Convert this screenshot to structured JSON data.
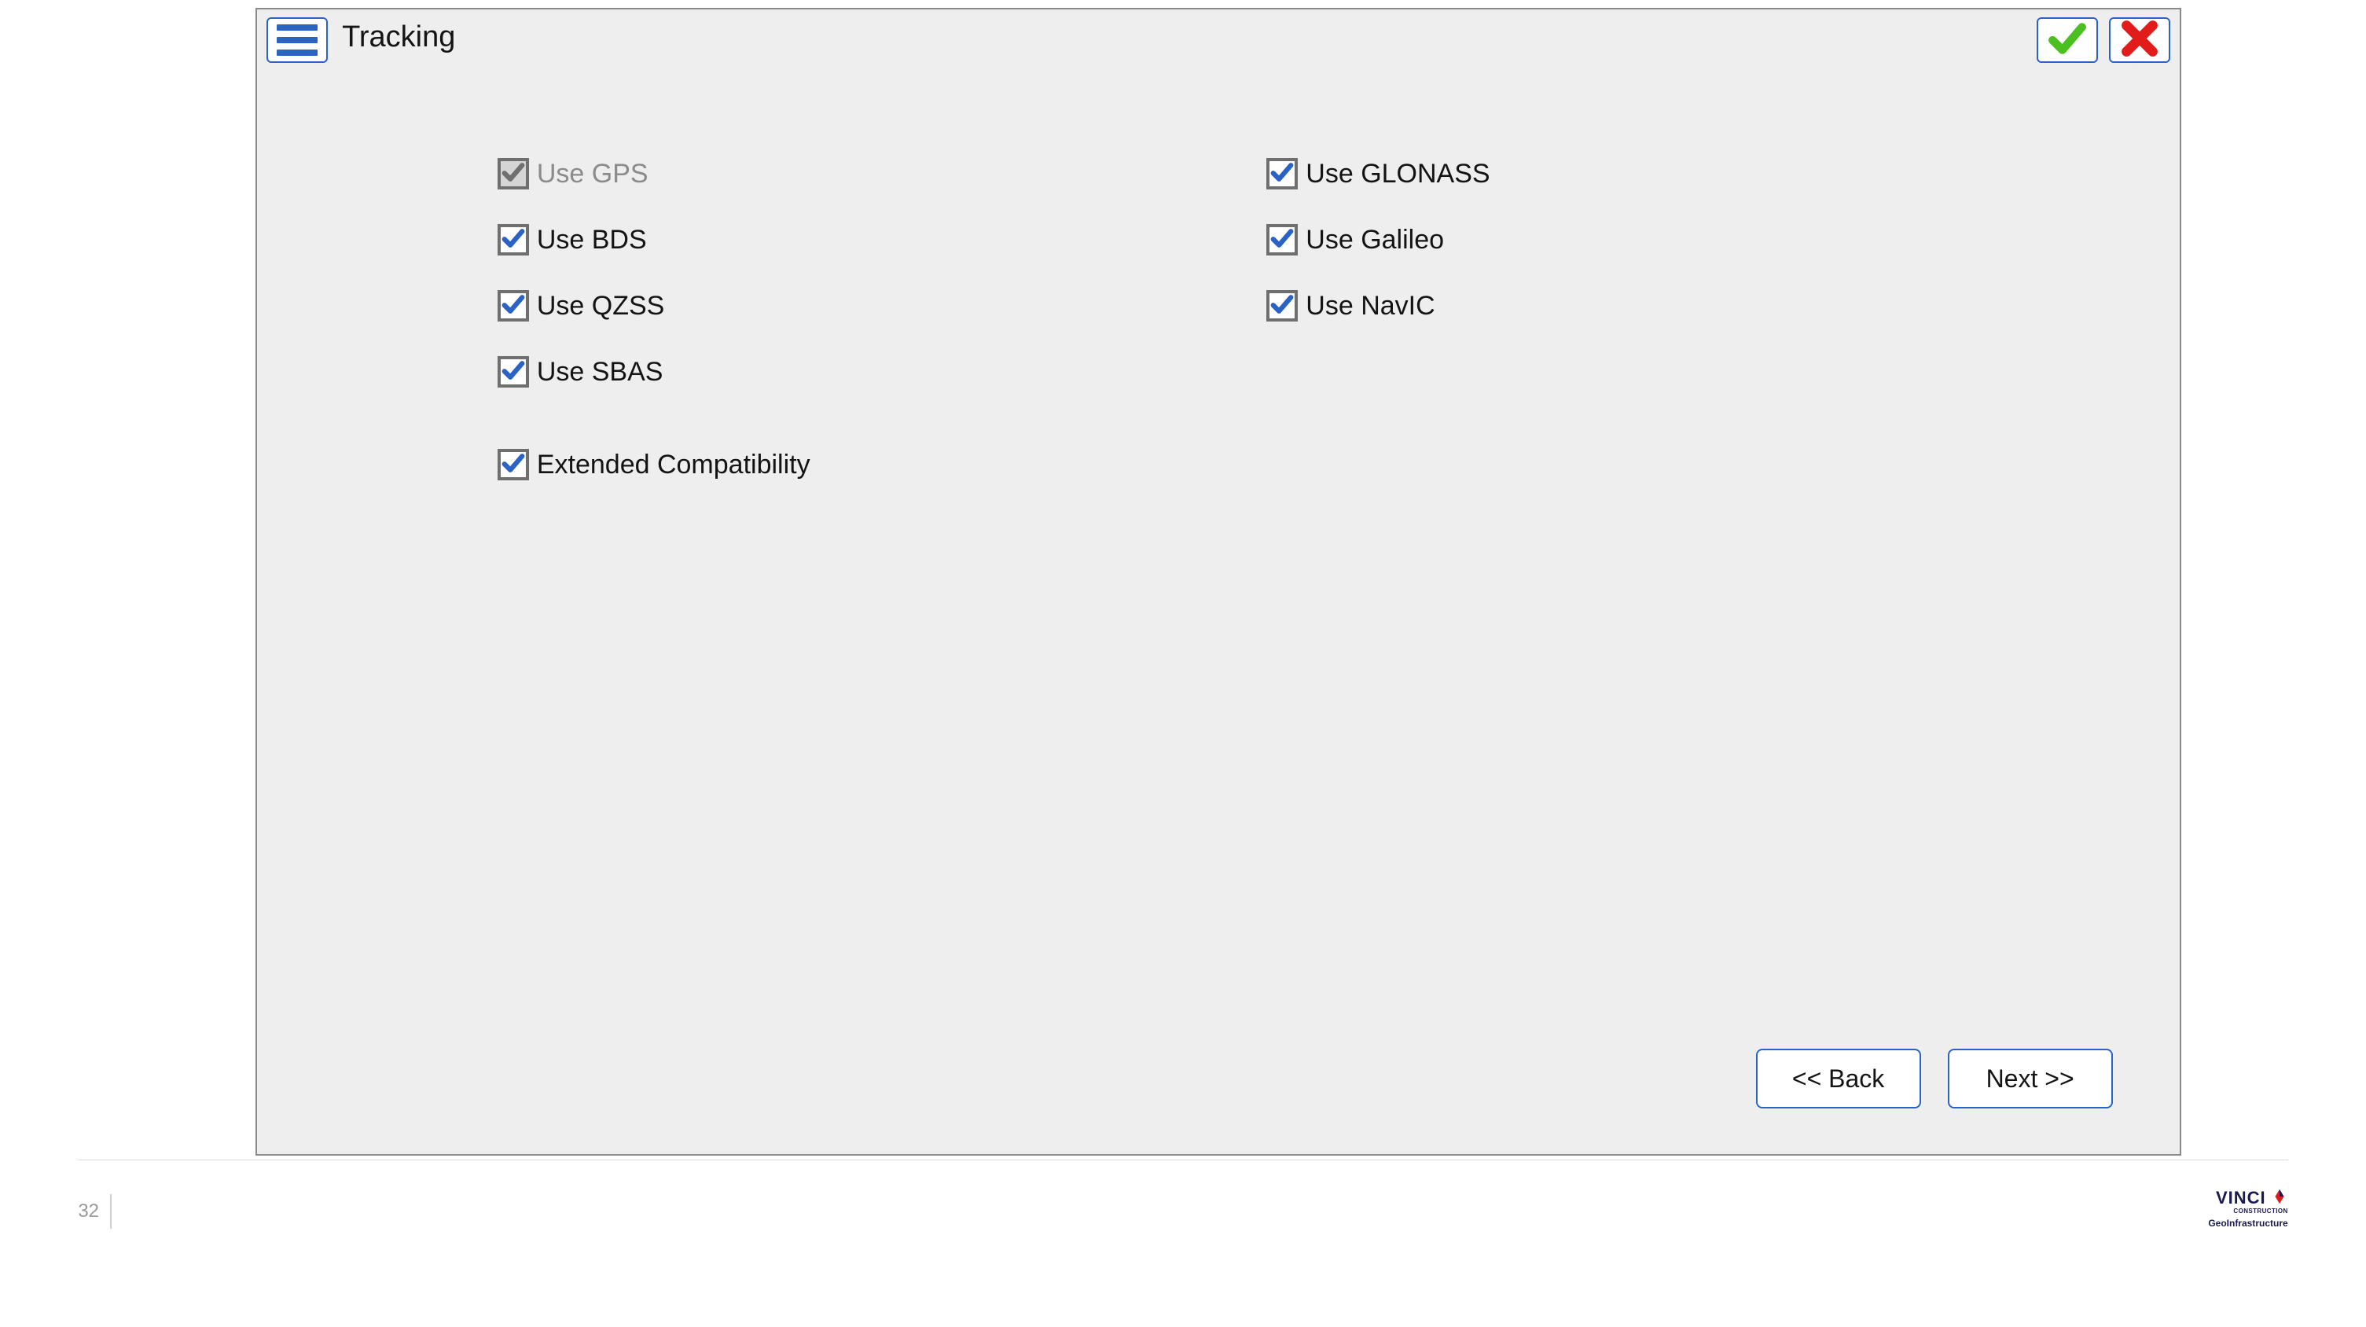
{
  "header": {
    "title": "Tracking"
  },
  "options": {
    "gps": {
      "label": "Use GPS",
      "checked": true,
      "disabled": true
    },
    "glonass": {
      "label": "Use GLONASS",
      "checked": true,
      "disabled": false
    },
    "bds": {
      "label": "Use BDS",
      "checked": true,
      "disabled": false
    },
    "galileo": {
      "label": "Use Galileo",
      "checked": true,
      "disabled": false
    },
    "qzss": {
      "label": "Use QZSS",
      "checked": true,
      "disabled": false
    },
    "navic": {
      "label": "Use NavIC",
      "checked": true,
      "disabled": false
    },
    "sbas": {
      "label": "Use SBAS",
      "checked": true,
      "disabled": false
    },
    "extcomp": {
      "label": "Extended Compatibility",
      "checked": true,
      "disabled": false
    }
  },
  "nav": {
    "back": "<< Back",
    "next": "Next >>"
  },
  "footer": {
    "page": "32",
    "brand_name": "VINCI",
    "brand_sub1": "CONSTRUCTION",
    "brand_sub2": "GeoInfrastructure"
  },
  "colors": {
    "accent": "#2a63c4",
    "ok": "#4bbf1f",
    "cancel": "#e21b1b"
  }
}
